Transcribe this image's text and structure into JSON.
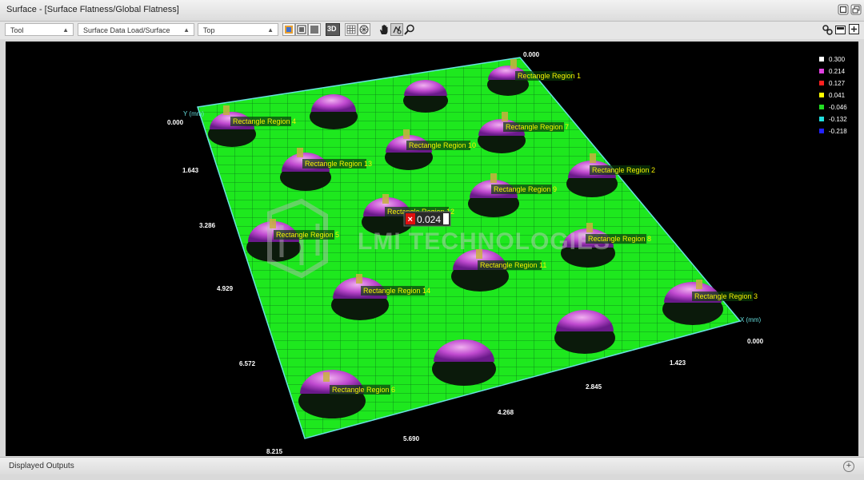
{
  "window": {
    "title": "Surface - [Surface Flatness/Global Flatness]"
  },
  "toolbar": {
    "tool_select": "Tool",
    "data_select": "Surface Data Load/Surface",
    "view_select": "Top",
    "btn_3d": "3D"
  },
  "viewer": {
    "y_axis_label": "Y (mm)",
    "x_axis_label": "X (mm)",
    "z_top_label": "0.000",
    "y_ticks": [
      "0.000",
      "1.643",
      "3.286",
      "4.929",
      "6.572",
      "8.215"
    ],
    "x_ticks": [
      "0.000",
      "1.423",
      "2.845",
      "4.268",
      "5.690"
    ],
    "regions": [
      {
        "label": "Rectangle Region 1"
      },
      {
        "label": "Rectangle Region 2"
      },
      {
        "label": "Rectangle Region 3"
      },
      {
        "label": "Rectangle Region 4"
      },
      {
        "label": "Rectangle Region 5"
      },
      {
        "label": "Rectangle Region 6"
      },
      {
        "label": "Rectangle Region 7"
      },
      {
        "label": "Rectangle Region 8"
      },
      {
        "label": "Rectangle Region 9"
      },
      {
        "label": "Rectangle Region 10"
      },
      {
        "label": "Rectangle Region 11"
      },
      {
        "label": "Rectangle Region 12"
      },
      {
        "label": "Rectangle Region 13"
      },
      {
        "label": "Rectangle Region 14"
      }
    ],
    "measurement_value": "0.024",
    "watermark": "LMI TECHNOLOGIES",
    "legend": [
      {
        "value": "0.300",
        "color": "#ffffff"
      },
      {
        "value": "0.214",
        "color": "#e040e0"
      },
      {
        "value": "0.127",
        "color": "#ff2020"
      },
      {
        "value": "0.041",
        "color": "#ffff00"
      },
      {
        "value": "-0.046",
        "color": "#22dd22"
      },
      {
        "value": "-0.132",
        "color": "#22dddd"
      },
      {
        "value": "-0.218",
        "color": "#2222ff"
      }
    ]
  },
  "bottom_bar": {
    "label": "Displayed Outputs"
  }
}
